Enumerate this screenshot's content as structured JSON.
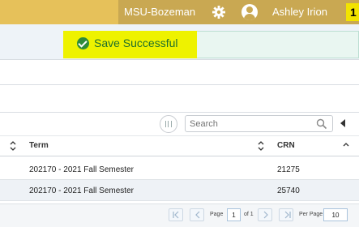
{
  "header": {
    "institution": "MSU-Bozeman",
    "user_name": "Ashley Irion",
    "badge": "1",
    "colors": {
      "bar": "#e6c15a",
      "bar_dark": "#c9a852",
      "badge": "#f2e300"
    }
  },
  "notification": {
    "message": "Save Successful",
    "icon": "check-circle-icon",
    "color": "#1f6e2c"
  },
  "toolbar": {
    "search_placeholder": "Search"
  },
  "table": {
    "columns": [
      "Term",
      "CRN"
    ],
    "rows": [
      {
        "term": "202170 - 2021 Fall Semester",
        "crn": "21275"
      },
      {
        "term": "202170 - 2021 Fall Semester",
        "crn": "25740"
      }
    ]
  },
  "pagination": {
    "page_label": "Page",
    "page_value": "1",
    "of_label": "of 1",
    "per_page_label": "Per Page",
    "per_page_value": "10"
  }
}
